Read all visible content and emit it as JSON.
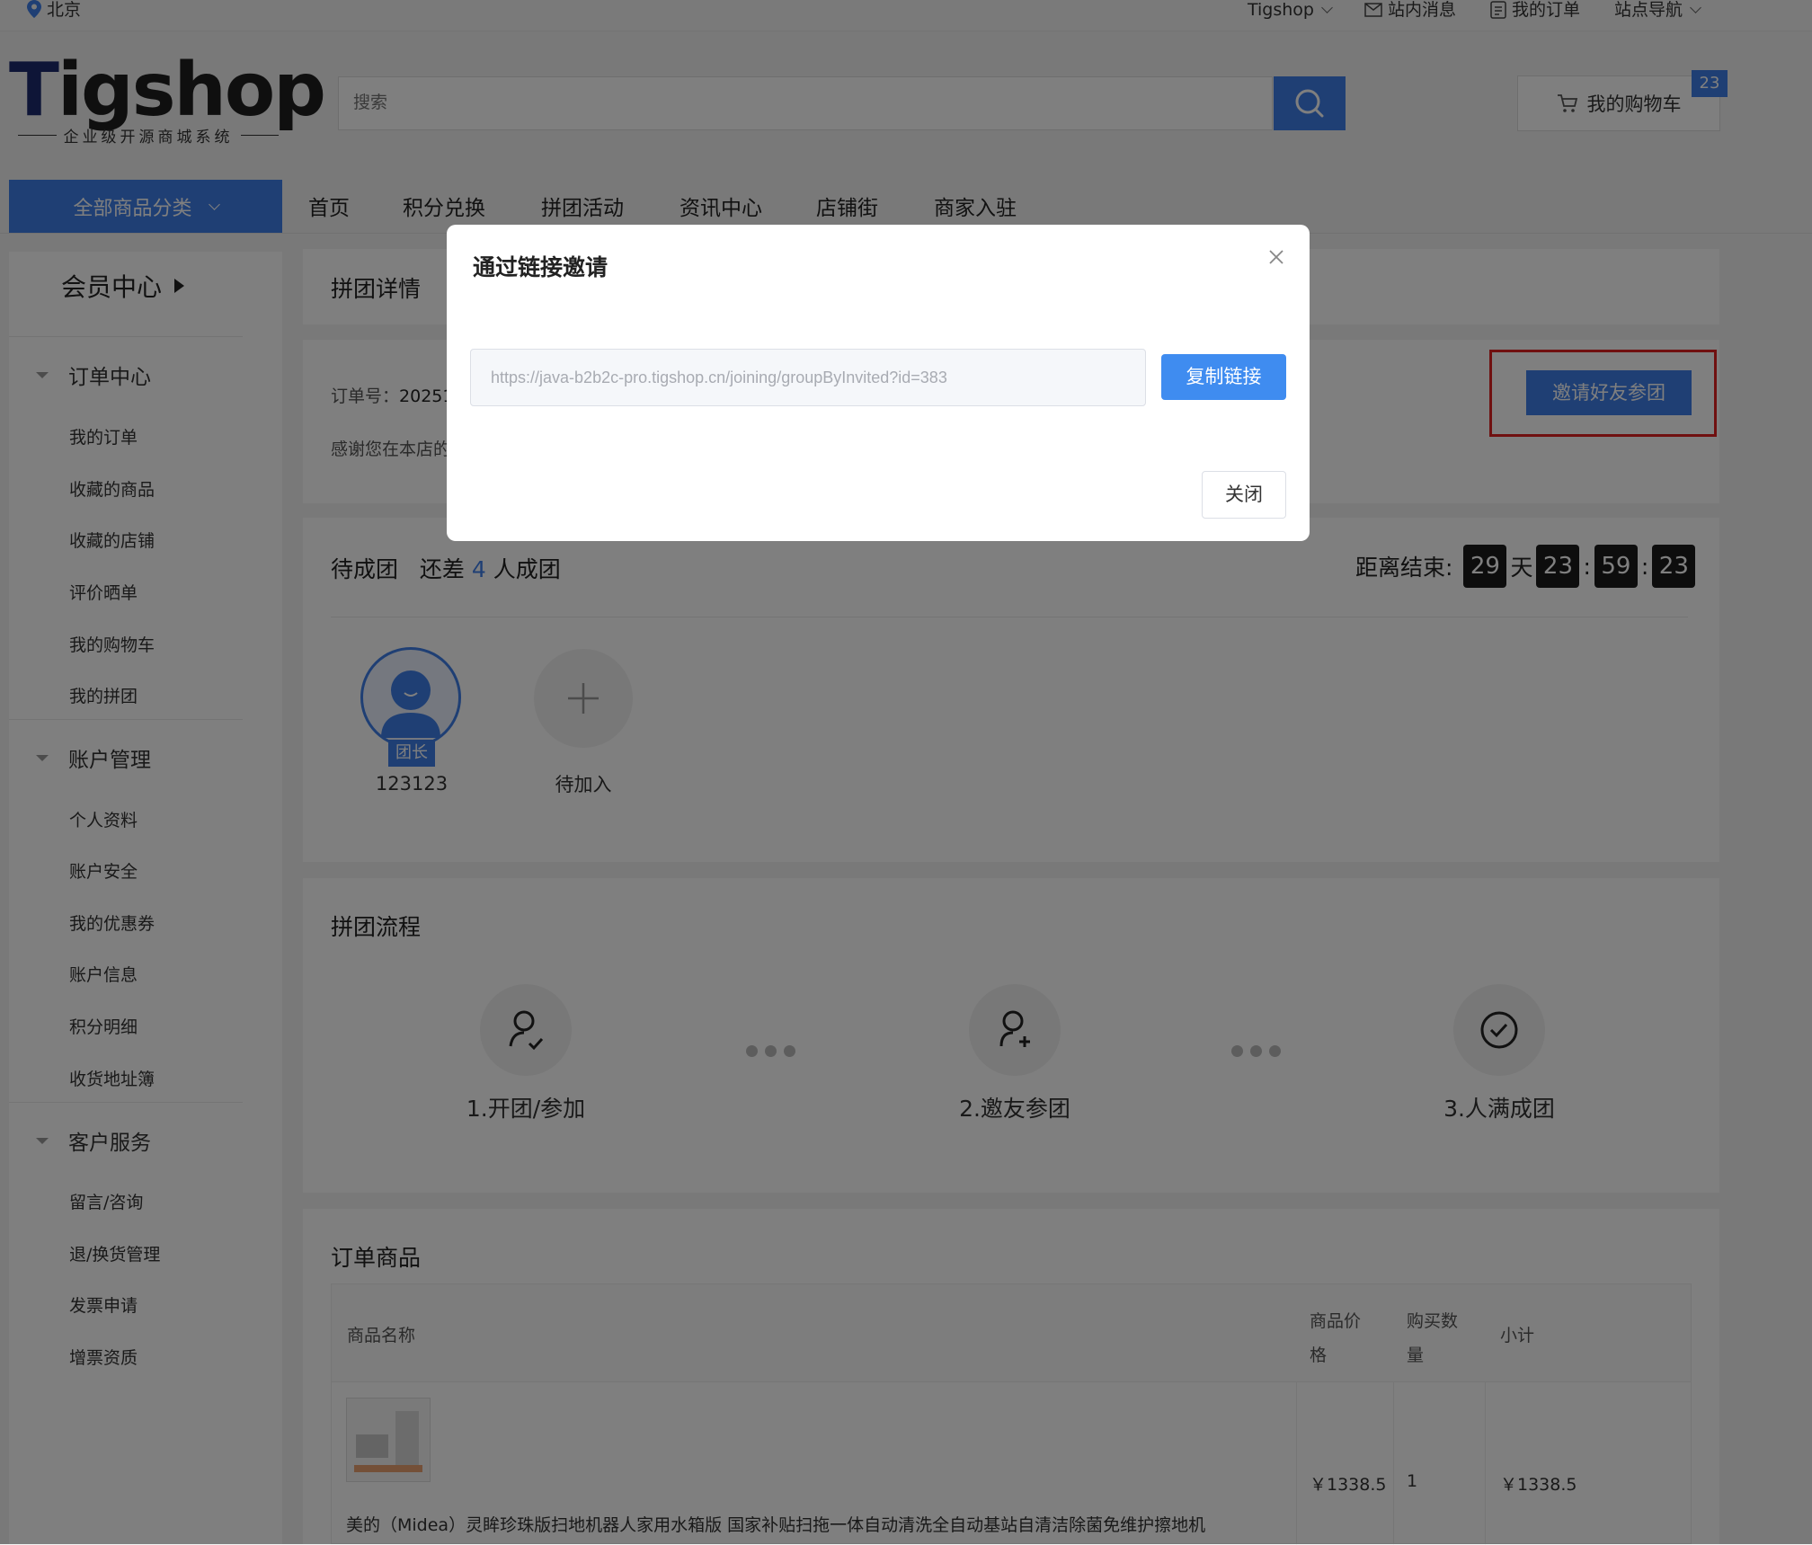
{
  "topbar": {
    "location": "北京",
    "brand_menu": "Tigshop",
    "messages": "站内消息",
    "my_orders": "我的订单",
    "site_nav": "站点导航"
  },
  "header": {
    "logo_text": "Tigshop",
    "logo_slogan": "企业级开源商城系统",
    "search_placeholder": "搜索",
    "cart_label": "我的购物车",
    "cart_count": "23"
  },
  "nav": {
    "all_categories": "全部商品分类",
    "items": [
      "首页",
      "积分兑换",
      "拼团活动",
      "资讯中心",
      "店铺街",
      "商家入驻"
    ]
  },
  "sidebar": {
    "title": "会员中心",
    "groups": [
      {
        "label": "订单中心",
        "items": [
          "我的订单",
          "收藏的商品",
          "收藏的店铺",
          "评价晒单",
          "我的购物车",
          "我的拼团"
        ]
      },
      {
        "label": "账户管理",
        "items": [
          "个人资料",
          "账户安全",
          "我的优惠券",
          "账户信息",
          "积分明细",
          "收货地址簿"
        ]
      },
      {
        "label": "客户服务",
        "items": [
          "留言/咨询",
          "退/换货管理",
          "发票申请",
          "增票资质"
        ]
      }
    ]
  },
  "group_detail": {
    "title": "拼团详情",
    "order_no_label": "订单号：",
    "order_no_partial": "20251",
    "thanks_partial": "感谢您在本店的",
    "invite_button": "邀请好友参团"
  },
  "group_status": {
    "status": "待成团",
    "need_prefix": "还差",
    "need_count": "4",
    "need_suffix": "人成团",
    "countdown_label": "距离结束:",
    "days": "29",
    "day_unit": "天",
    "hours": "23",
    "minutes": "59",
    "seconds": "23",
    "sep": ":",
    "leader_tag": "团长",
    "leader_name": "123123",
    "pending_label": "待加入"
  },
  "process": {
    "title": "拼团流程",
    "steps": [
      "1.开团/参加",
      "2.邀友参团",
      "3.人满成团"
    ]
  },
  "order_goods": {
    "title": "订单商品",
    "headers": {
      "name": "商品名称",
      "price_a": "商品价",
      "price_b": "格",
      "qty_a": "购买数",
      "qty_b": "量",
      "subtotal": "小计"
    },
    "rows": [
      {
        "name": "美的（Midea）灵眸珍珠版扫地机器人家用水箱版 国家补贴扫拖一体自动清洗全自动基站自清洁除菌免维护擦地机",
        "price": "￥1338.5",
        "qty": "1",
        "subtotal": "￥1338.5"
      }
    ]
  },
  "modal": {
    "title": "通过链接邀请",
    "link": "https://java-b2b2c-pro.tigshop.cn/joining/groupByInvited?id=383",
    "copy_button": "复制链接",
    "close_button": "关闭"
  },
  "colors": {
    "accent": "#3f7ee8",
    "highlight_border": "#e02020",
    "countdown_bg": "#1a1a1a"
  }
}
